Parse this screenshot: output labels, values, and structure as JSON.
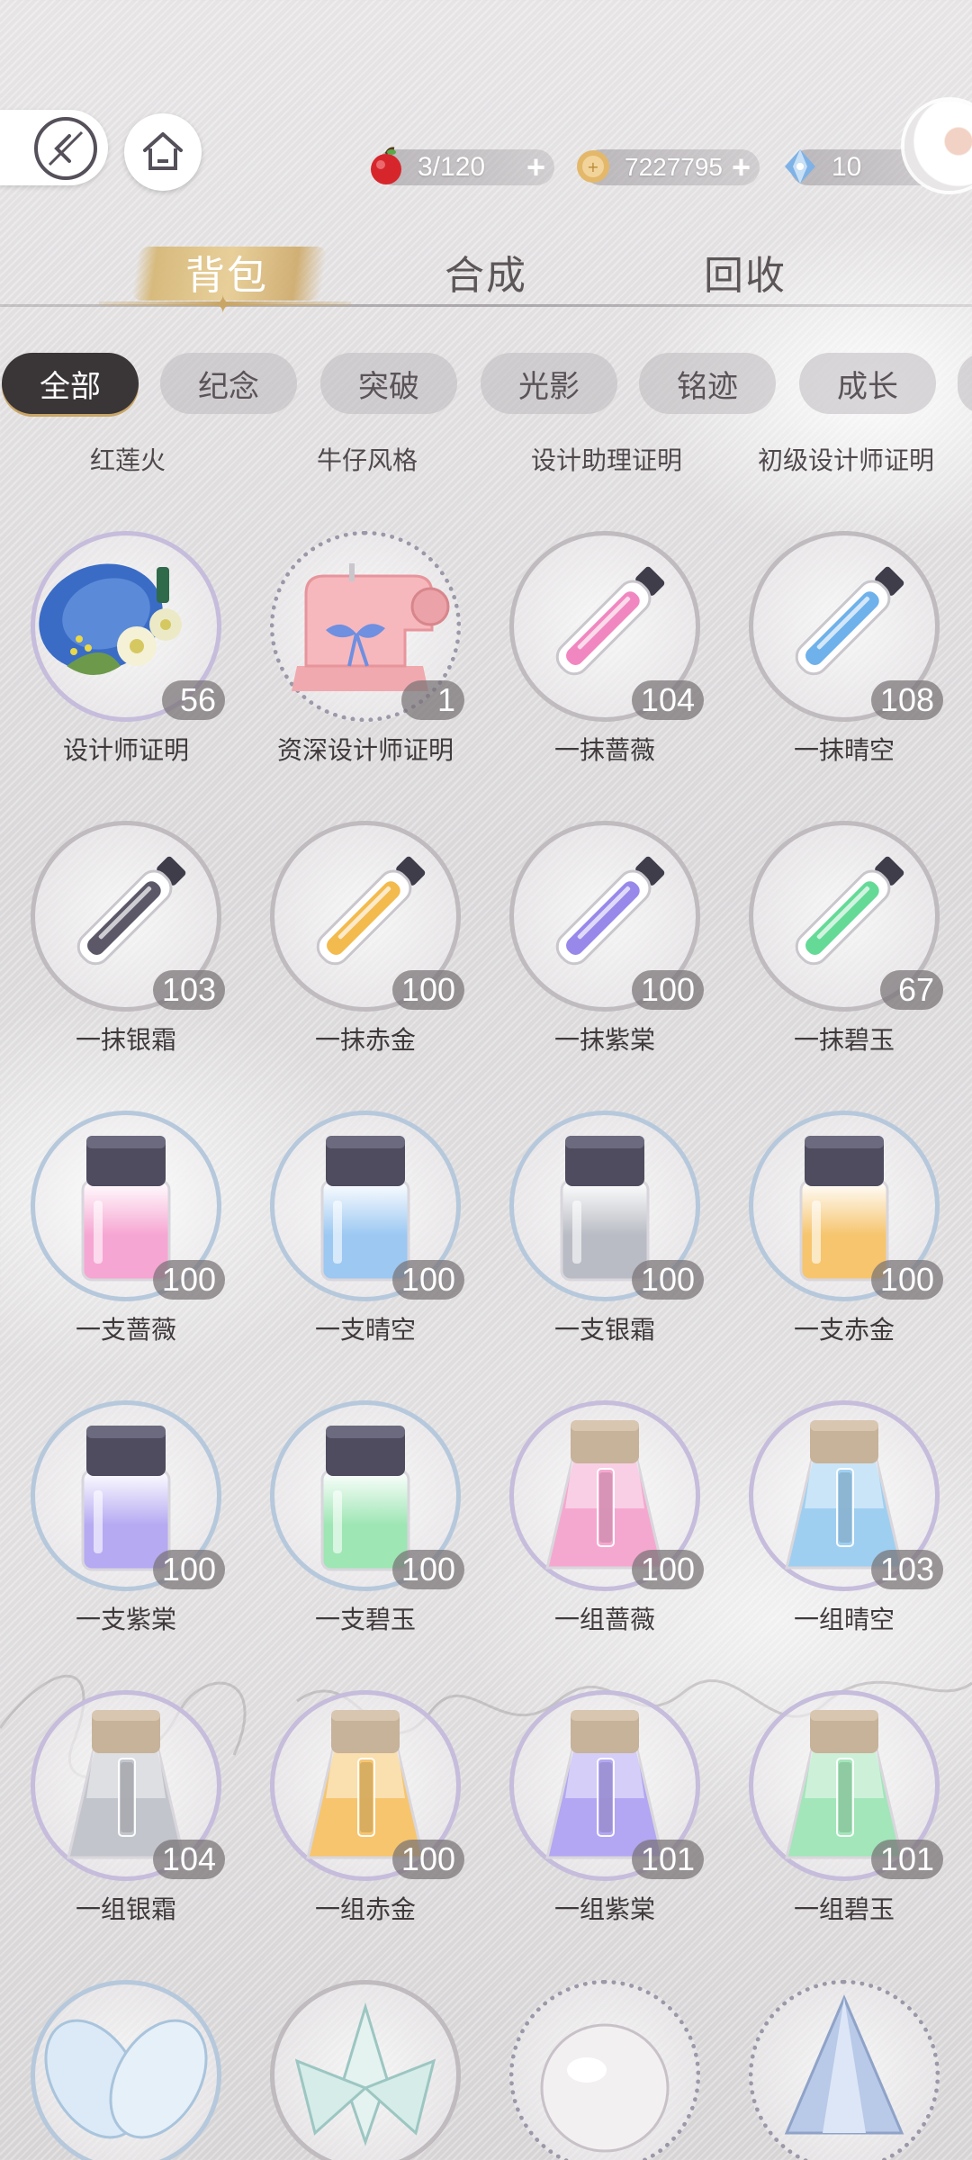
{
  "topbar": {
    "stamina": "3/120",
    "gold": "7227795",
    "gems": "10",
    "plus": "+"
  },
  "tabs": [
    {
      "label": "背包",
      "active": true
    },
    {
      "label": "合成",
      "active": false
    },
    {
      "label": "回收",
      "active": false
    }
  ],
  "filters": [
    {
      "label": "全部",
      "active": true
    },
    {
      "label": "纪念",
      "active": false
    },
    {
      "label": "突破",
      "active": false
    },
    {
      "label": "光影",
      "active": false
    },
    {
      "label": "铭迹",
      "active": false
    },
    {
      "label": "成长",
      "active": false
    }
  ],
  "top_row_labels": [
    "红莲火",
    "牛仔风格",
    "设计助理证明",
    "初级设计师证明"
  ],
  "items": [
    {
      "name": "设计师证明",
      "count": "56",
      "icon": "designer-certificate-hat-icon"
    },
    {
      "name": "资深设计师证明",
      "count": "1",
      "icon": "sewing-machine-icon"
    },
    {
      "name": "一抹蔷薇",
      "count": "104",
      "icon": "perfume-vial-icon",
      "color": "#f07ab9"
    },
    {
      "name": "一抹晴空",
      "count": "108",
      "icon": "perfume-vial-icon",
      "color": "#5fa8e8"
    },
    {
      "name": "一抹银霜",
      "count": "103",
      "icon": "perfume-vial-icon",
      "color": "#4a4658"
    },
    {
      "name": "一抹赤金",
      "count": "100",
      "icon": "perfume-vial-icon",
      "color": "#f2b33a"
    },
    {
      "name": "一抹紫棠",
      "count": "100",
      "icon": "perfume-vial-icon",
      "color": "#8c7be8"
    },
    {
      "name": "一抹碧玉",
      "count": "67",
      "icon": "perfume-vial-icon",
      "color": "#54d68c"
    },
    {
      "name": "一支蔷薇",
      "count": "100",
      "icon": "perfume-jar-icon",
      "color": "#f6a6d2"
    },
    {
      "name": "一支晴空",
      "count": "100",
      "icon": "perfume-jar-icon",
      "color": "#9cc8f2"
    },
    {
      "name": "一支银霜",
      "count": "100",
      "icon": "perfume-jar-icon",
      "color": "#b9bcc4"
    },
    {
      "name": "一支赤金",
      "count": "100",
      "icon": "perfume-jar-icon",
      "color": "#f6c56e"
    },
    {
      "name": "一支紫棠",
      "count": "100",
      "icon": "perfume-jar-icon",
      "color": "#b6aaf2"
    },
    {
      "name": "一支碧玉",
      "count": "100",
      "icon": "perfume-jar-icon",
      "color": "#9ee6b4"
    },
    {
      "name": "一组蔷薇",
      "count": "100",
      "icon": "perfume-bottle-icon",
      "color": "#f5a8cf"
    },
    {
      "name": "一组晴空",
      "count": "103",
      "icon": "perfume-bottle-icon",
      "color": "#9fcff0"
    },
    {
      "name": "一组银霜",
      "count": "104",
      "icon": "perfume-bottle-icon",
      "color": "#c3c5cc"
    },
    {
      "name": "一组赤金",
      "count": "100",
      "icon": "perfume-bottle-icon",
      "color": "#f6c56e"
    },
    {
      "name": "一组紫棠",
      "count": "101",
      "icon": "perfume-bottle-icon",
      "color": "#b3a6f2"
    },
    {
      "name": "一组碧玉",
      "count": "101",
      "icon": "perfume-bottle-icon",
      "color": "#a2e6b9"
    }
  ],
  "partial_row_icons": [
    "white-flower-icon",
    "jasmine-flower-icon",
    "pearl-icon",
    "crystal-icon"
  ],
  "colors": {
    "accent_gold": "#c9a668",
    "chip_active": "#3a3537",
    "stamina_apple": "#d6262c",
    "coin": "#e3b86a"
  }
}
